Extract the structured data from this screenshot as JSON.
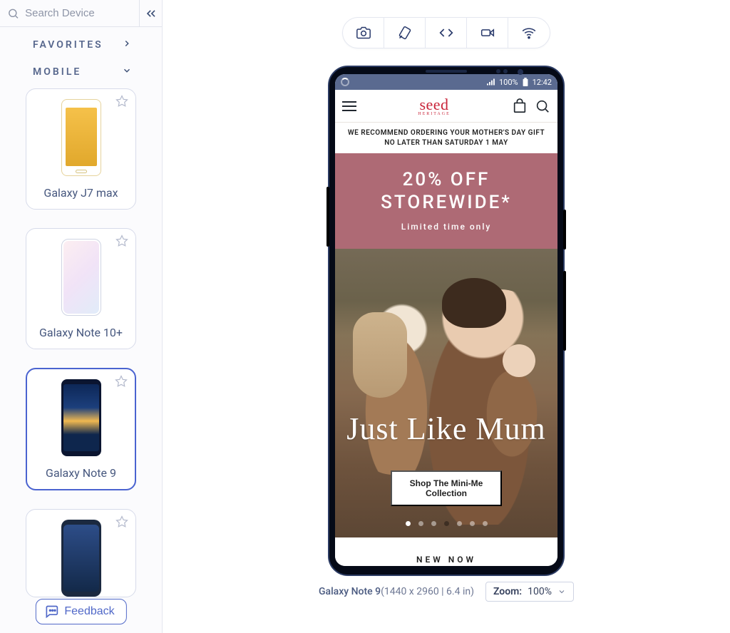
{
  "search": {
    "placeholder": "Search Device"
  },
  "sections": {
    "favorites": "FAVORITES",
    "mobile": "MOBILE"
  },
  "devices": [
    {
      "name": "Galaxy J7 max"
    },
    {
      "name": "Galaxy Note 10+"
    },
    {
      "name": "Galaxy Note 9"
    },
    {
      "name": ""
    }
  ],
  "feedback_label": "Feedback",
  "mobile_emulator": {
    "status": {
      "battery_pct": "100%",
      "time": "12:42"
    },
    "brand": {
      "name": "seed",
      "tag": "HERITAGE"
    },
    "banner": "WE RECOMMEND ORDERING YOUR MOTHER'S DAY GIFT NO LATER THAN SATURDAY 1 MAY",
    "promo": {
      "line1": "20% OFF",
      "line2": "STOREWIDE*",
      "line3": "Limited time only"
    },
    "hero": {
      "script": "Just Like Mum",
      "cta": "Shop The Mini-Me Collection"
    },
    "next_section": "NEW NOW"
  },
  "footer": {
    "device_name": "Galaxy Note 9",
    "resolution": "(1440 x 2960 | 6.4 in)",
    "zoom_label": "Zoom:",
    "zoom_value": "100%"
  }
}
